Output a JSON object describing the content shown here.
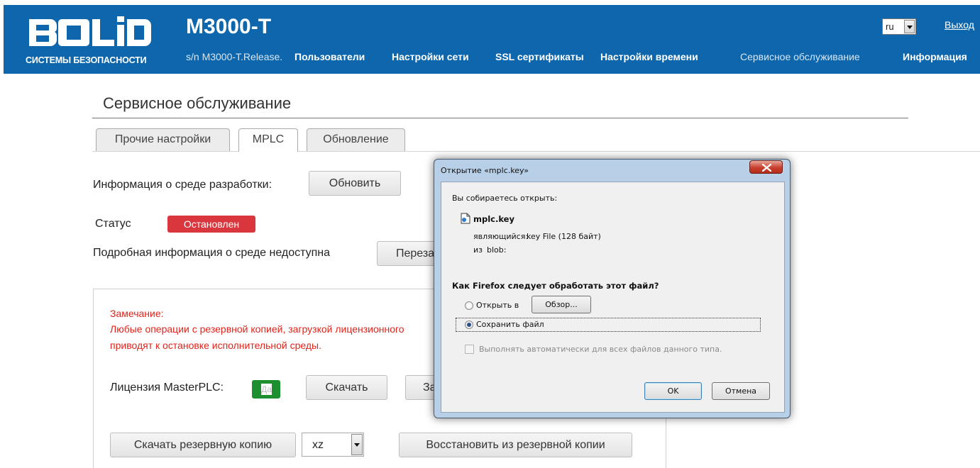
{
  "header": {
    "logo_text": "BOLID",
    "logo_subtitle": "СИСТЕМЫ БЕЗОПАСНОСТИ",
    "product": "М3000-T",
    "serial": "s/n M3000-T.Release.",
    "nav": [
      {
        "label": "Пользователи",
        "active": false
      },
      {
        "label": "Настройки сети",
        "active": false
      },
      {
        "label": "SSL сертификаты",
        "active": false
      },
      {
        "label": "Настройки времени",
        "active": false
      },
      {
        "label": "Сервисное обслуживание",
        "active": true
      },
      {
        "label": "Информация",
        "active": false
      }
    ],
    "language": "ru",
    "logout": "Выход"
  },
  "page": {
    "title": "Сервисное обслуживание",
    "tabs": [
      {
        "label": "Прочие настройки",
        "active": false
      },
      {
        "label": "MPLC",
        "active": true
      },
      {
        "label": "Обновление",
        "active": false
      }
    ],
    "dev_env_label": "Информация о среде разработки:",
    "refresh_button": "Обновить",
    "status_label": "Статус",
    "status_value": "Остановлен",
    "details_label": "Подробная информация о среде недоступна",
    "restart_button": "Перезапустить"
  },
  "panel": {
    "note_title": "Замечание:",
    "note_line1": "Любые операции с резервной копией, загрузкой лицензионного",
    "note_line2": "приводят к остановке исполнительной среды.",
    "license_label": "Лицензия MasterPLC:",
    "license_badge": "Да",
    "download_button": "Скачать",
    "upload_button": "Загрузить",
    "backup_download_button": "Скачать резервную копию",
    "backup_format": "xz",
    "restore_button": "Восстановить из резервной копии"
  },
  "dialog": {
    "title": "Открытие «mplc.key»",
    "intro": "Вы собираетесь открыть:",
    "filename": "mplc.key",
    "type_label": "являющийся:",
    "type_value": "key File (128 байт)",
    "from_label": "из",
    "from_value": "blob:",
    "question": "Как Firefox следует обработать этот файл?",
    "open_with": "Открыть в",
    "browse_button": "Обзор...",
    "save_file": "Сохранить файл",
    "auto_checkbox": "Выполнять автоматически для всех файлов данного типа.",
    "ok_button": "OK",
    "cancel_button": "Отмена",
    "selected_option": "save"
  },
  "colors": {
    "header_bg": "#0e67ad",
    "status_red": "#d9363e",
    "license_green": "#1e8f2f",
    "note_red": "#e2231a"
  }
}
